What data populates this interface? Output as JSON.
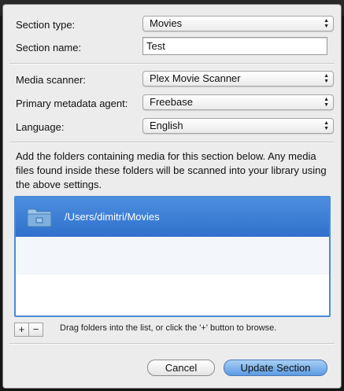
{
  "form": {
    "section_type_label": "Section type:",
    "section_type_value": "Movies",
    "section_name_label": "Section name:",
    "section_name_value": "Test",
    "media_scanner_label": "Media scanner:",
    "media_scanner_value": "Plex Movie Scanner",
    "agent_label": "Primary metadata agent:",
    "agent_value": "Freebase",
    "language_label": "Language:",
    "language_value": "English"
  },
  "folders": {
    "description": "Add the folders containing media for this section below. Any media files found inside these folders will be scanned into your library using the above settings.",
    "items": [
      {
        "path": "/Users/dimitri/Movies",
        "icon": "folder-icon",
        "selected": true
      }
    ],
    "add_label": "+",
    "remove_label": "−",
    "hint": "Drag folders into the list, or click the '+' button to browse."
  },
  "buttons": {
    "cancel": "Cancel",
    "update": "Update Section"
  },
  "colors": {
    "selection": "#3b7dd8",
    "default_button": "#5b9be3",
    "sheet_bg": "#ececec"
  }
}
